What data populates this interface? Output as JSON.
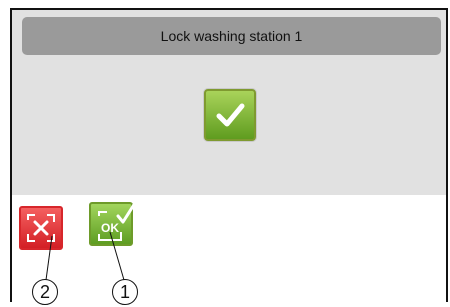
{
  "dialog": {
    "title": "Lock washing station 1"
  },
  "buttons": {
    "confirm": {
      "icon": "checkmark-icon"
    },
    "cancel": {
      "icon": "cancel-x-icon",
      "color": "#e03036"
    },
    "ok": {
      "icon": "ok-check-icon",
      "label": "OK",
      "color": "#7dbb3a"
    }
  },
  "callouts": {
    "cancel_number": "2",
    "ok_number": "1"
  }
}
